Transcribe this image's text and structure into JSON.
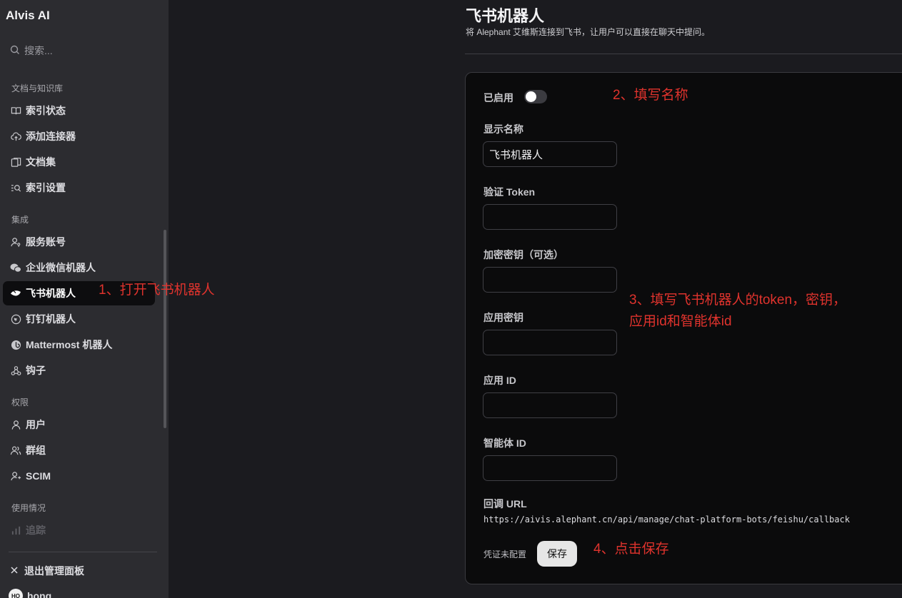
{
  "app": {
    "title": "Alvis AI"
  },
  "search": {
    "placeholder": "搜索..."
  },
  "sidebar": {
    "sections": [
      {
        "label": "文档与知识库"
      },
      {
        "label": "集成"
      },
      {
        "label": "权限"
      },
      {
        "label": "使用情况"
      }
    ],
    "items": [
      {
        "label": "索引状态",
        "icon": "book-icon"
      },
      {
        "label": "添加连接器",
        "icon": "cloud-upload-icon"
      },
      {
        "label": "文档集",
        "icon": "documents-icon"
      },
      {
        "label": "索引设置",
        "icon": "index-settings-icon"
      },
      {
        "label": "服务账号",
        "icon": "user-key-icon"
      },
      {
        "label": "企业微信机器人",
        "icon": "wechat-icon"
      },
      {
        "label": "飞书机器人",
        "icon": "feishu-icon",
        "active": true
      },
      {
        "label": "钉钉机器人",
        "icon": "dingtalk-icon"
      },
      {
        "label": "Mattermost 机器人",
        "icon": "mattermost-icon"
      },
      {
        "label": "钩子",
        "icon": "webhook-icon"
      },
      {
        "label": "用户",
        "icon": "user-icon"
      },
      {
        "label": "群组",
        "icon": "users-icon"
      },
      {
        "label": "SCIM",
        "icon": "user-sync-icon"
      },
      {
        "label": "追踪",
        "icon": "chart-icon"
      }
    ],
    "exit_label": "退出管理面板",
    "user": {
      "initials": "HO",
      "name": "hong"
    }
  },
  "page": {
    "title": "飞书机器人",
    "subtitle": "将 Alephant 艾维斯连接到飞书，让用户可以直接在聊天中提问。"
  },
  "form": {
    "enabled_label": "已启用",
    "enabled": false,
    "display_name_label": "显示名称",
    "display_name_value": "飞书机器人",
    "verify_token_label": "验证 Token",
    "encrypt_key_label": "加密密钥（可选）",
    "app_secret_label": "应用密钥",
    "app_id_label": "应用 ID",
    "agent_id_label": "智能体 ID",
    "callback_label": "回调 URL",
    "callback_url": "https://aivis.alephant.cn/api/manage/chat-platform-bots/feishu/callback",
    "status_text": "凭证未配置",
    "save_label": "保存"
  },
  "annotations": {
    "step1": "1、打开飞书机器人",
    "step2": "2、填写名称",
    "step3_line1": "3、填写飞书机器人的token，密钥，",
    "step3_line2": "应用id和智能体id",
    "step4": "4、点击保存",
    "color": "#e0332d"
  }
}
